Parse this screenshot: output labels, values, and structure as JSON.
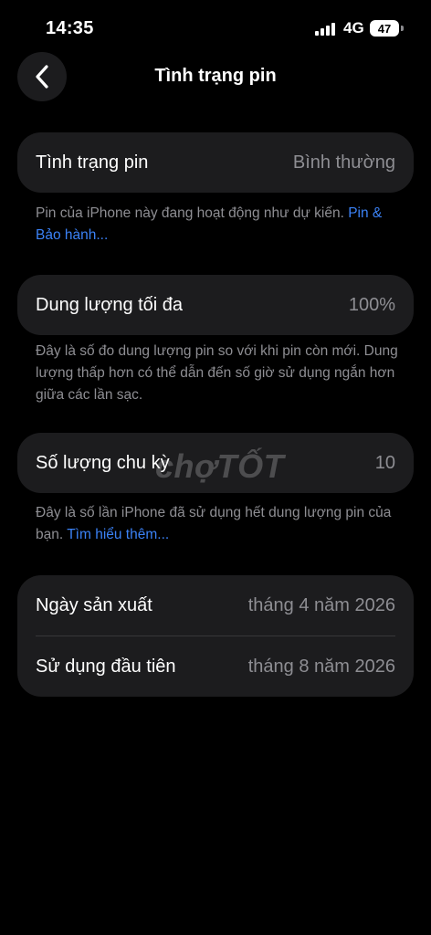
{
  "status": {
    "time": "14:35",
    "network": "4G",
    "battery": "47"
  },
  "nav": {
    "title": "Tình trạng pin"
  },
  "health": {
    "label": "Tình trạng pin",
    "value": "Bình thường",
    "note": "Pin của iPhone này đang hoạt động như dự kiến. ",
    "note_link": "Pin & Bảo hành..."
  },
  "capacity": {
    "label": "Dung lượng tối đa",
    "value": "100%",
    "note": "Đây là số đo dung lượng pin so với khi pin còn mới. Dung lượng thấp hơn có thể dẫn đến số giờ sử dụng ngắn hơn giữa các lần sạc."
  },
  "cycles": {
    "label": "Số lượng chu kỳ",
    "value": "10",
    "note": "Đây là số lần iPhone đã sử dụng hết dung lượng pin của bạn. ",
    "note_link": "Tìm hiểu thêm..."
  },
  "dates": {
    "manufacture_label": "Ngày sản xuất",
    "manufacture_value": "tháng 4 năm 2026",
    "first_use_label": "Sử dụng đầu tiên",
    "first_use_value": "tháng 8 năm 2026"
  },
  "watermark": "chợTỐT"
}
